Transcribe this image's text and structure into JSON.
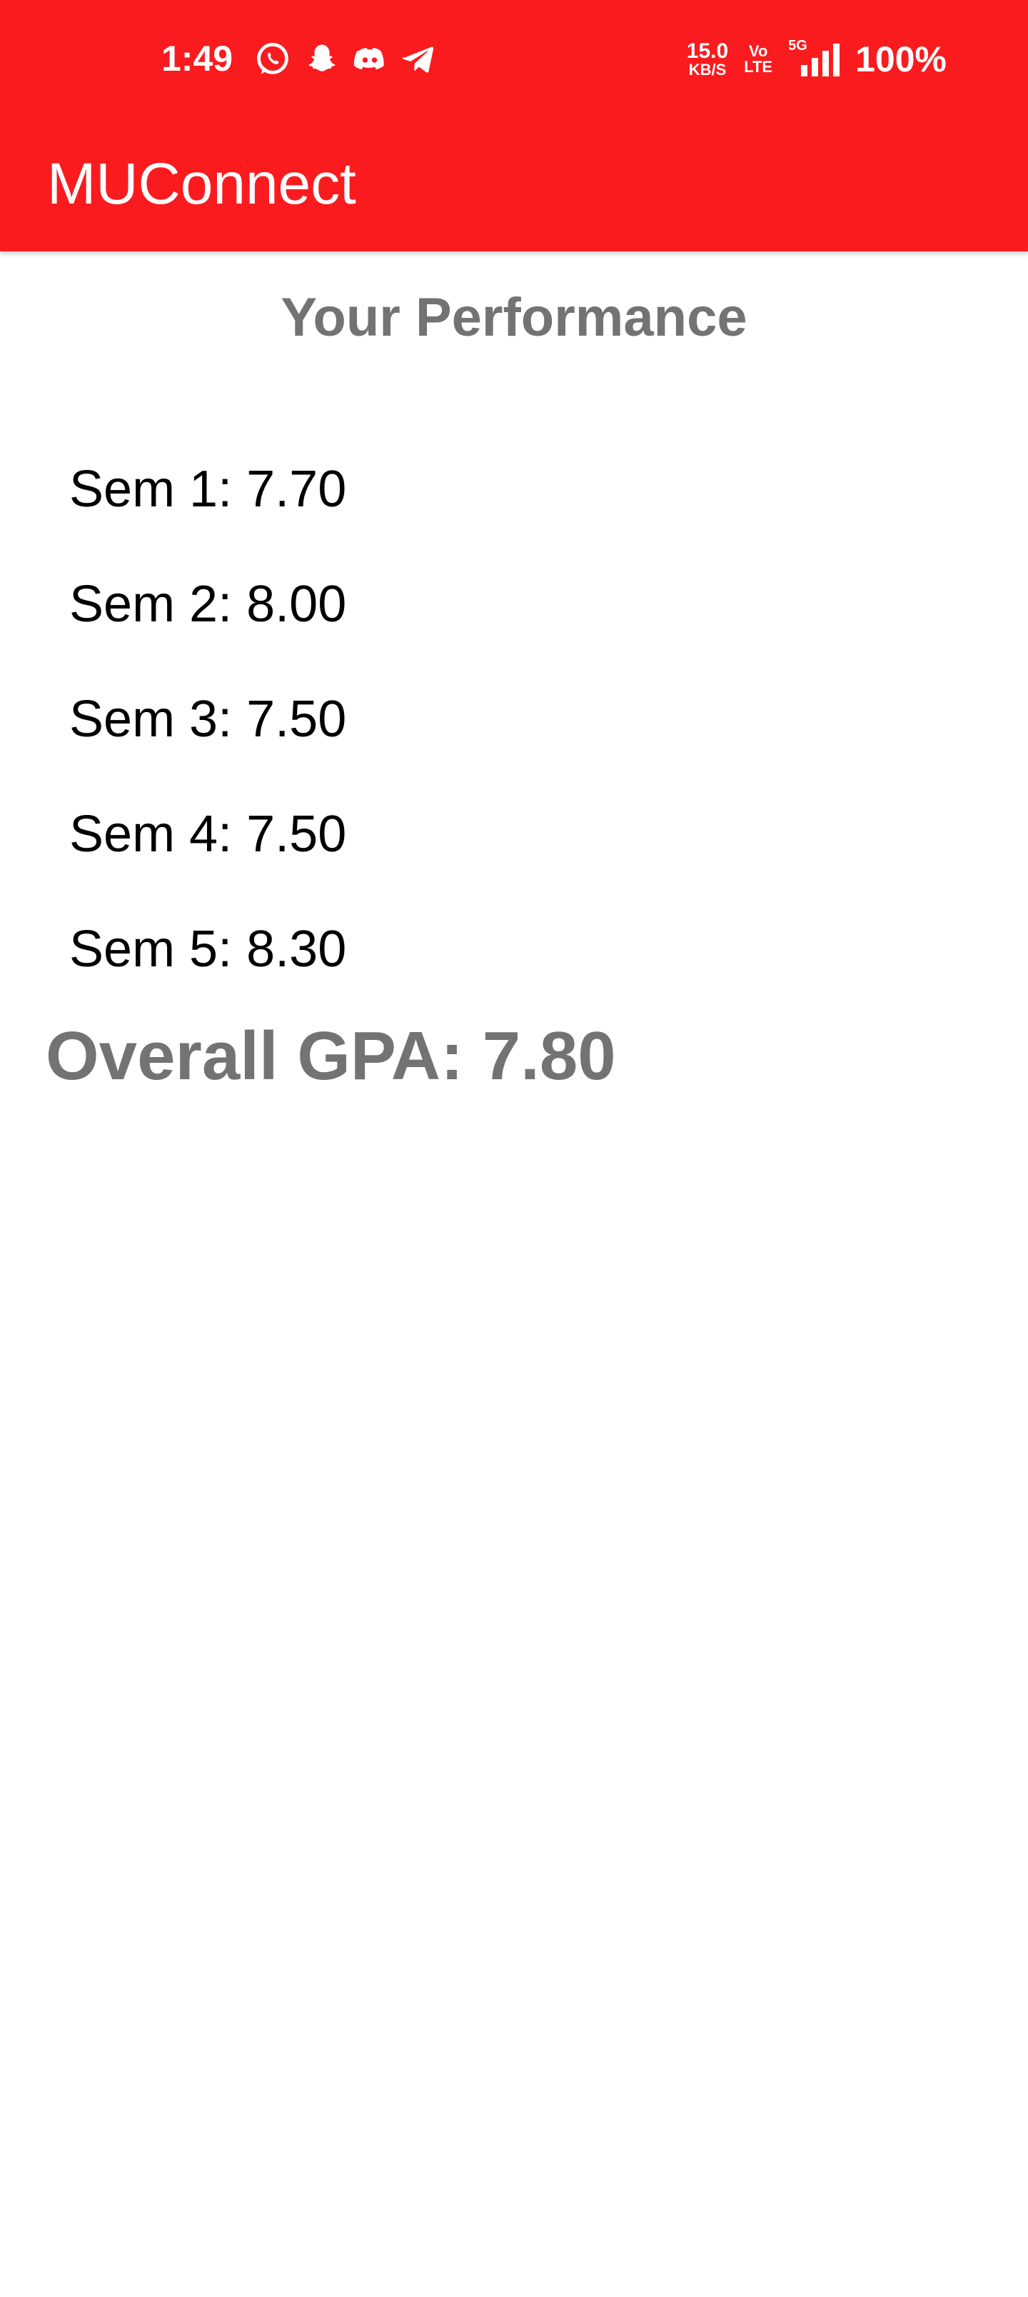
{
  "status_bar": {
    "time": "1:49",
    "notification_icons": [
      "whatsapp-icon",
      "snapchat-icon",
      "discord-icon",
      "telegram-icon"
    ],
    "net_speed": "15.0",
    "net_speed_unit": "KB/S",
    "volte_top": "Vo",
    "volte_bottom": "LTE",
    "network_type": "5G",
    "battery": "100%"
  },
  "app_bar": {
    "title": "MUConnect",
    "color": "#fa1b1e"
  },
  "performance": {
    "title": "Your Performance",
    "semesters": [
      "Sem 1: 7.70",
      "Sem 2: 8.00",
      "Sem 3: 7.50",
      "Sem 4: 7.50",
      "Sem 5: 8.30"
    ],
    "overall": "Overall GPA: 7.80"
  }
}
